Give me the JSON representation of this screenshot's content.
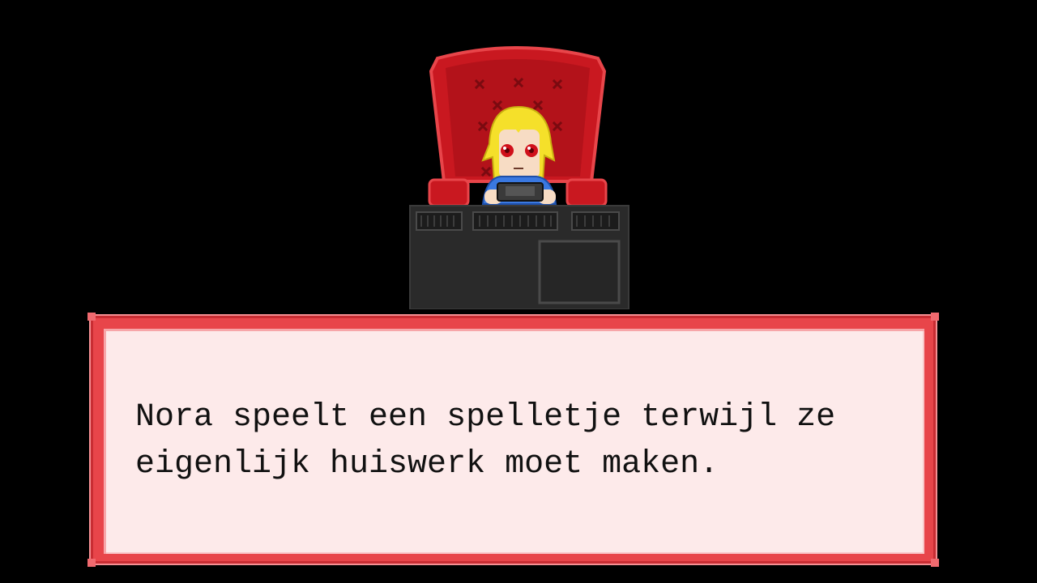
{
  "scene": {
    "character": "Nora",
    "sprite": {
      "chair_icon": "armchair-icon",
      "character_icon": "girl-with-handheld-icon",
      "console_icon": "handheld-console-icon",
      "desk_icon": "desk-icon"
    }
  },
  "dialog": {
    "text": "Nora speelt een spelletje terwijl ze eigenlijk huiswerk moet maken."
  },
  "colors": {
    "background": "#000000",
    "chair_red": "#c91820",
    "dialog_border": "#e8454a",
    "dialog_fill": "#fdeaea",
    "hair_yellow": "#f5e02a",
    "eyes_red": "#d0101a",
    "shirt_blue": "#3a78e0",
    "desk_dark": "#2a2a2a"
  }
}
